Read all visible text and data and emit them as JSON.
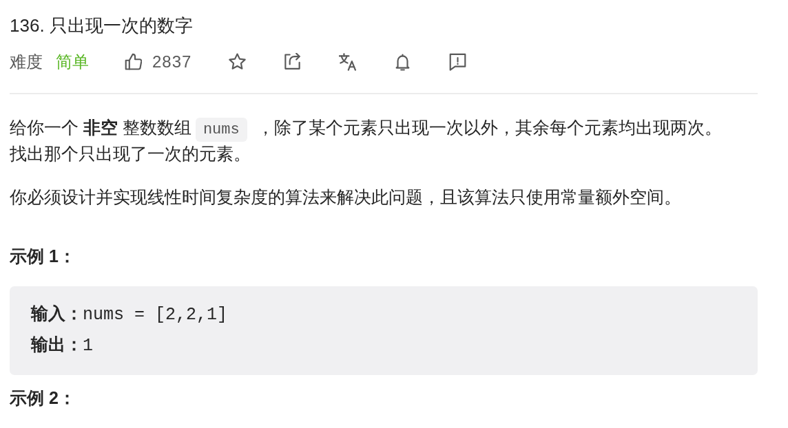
{
  "problem": {
    "title": "136. 只出现一次的数字"
  },
  "meta": {
    "difficulty_label": "难度",
    "difficulty": "简单",
    "likes": "2837"
  },
  "description": [
    {
      "segments": [
        {
          "kind": "text",
          "text": "给你一个 **非空** 整数数组"
        },
        {
          "kind": "code",
          "text": "nums"
        },
        {
          "kind": "text",
          "text": "，除了某个元素只出现一次以外，其余每个元素均出现两次。找出那个只出现了一次的元素。"
        }
      ]
    },
    {
      "segments": [
        {
          "kind": "text",
          "text": "你必须设计并实现线性时间复杂度的算法来解决此问题，且该算法只使用常量额外空间。"
        }
      ]
    }
  ],
  "examples": [
    {
      "heading": "示例 1：",
      "lines": [
        "**输入：**nums = [2,2,1]",
        "**输出：**1"
      ]
    },
    {
      "heading": "示例 2："
    }
  ]
}
